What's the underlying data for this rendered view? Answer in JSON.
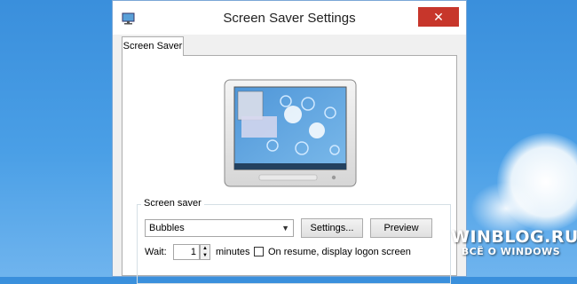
{
  "window": {
    "title": "Screen Saver Settings",
    "close_glyph": "✕",
    "app_icon": "monitor-icon",
    "close_color": "#c7362b"
  },
  "tabs": [
    {
      "label": "Screen Saver",
      "selected": true
    }
  ],
  "screen_saver_group": {
    "label": "Screen saver",
    "selected_saver": "Bubbles",
    "settings_button": "Settings...",
    "preview_button": "Preview",
    "wait_label": "Wait:",
    "wait_value": "1",
    "minutes_label": "minutes",
    "resume_checkbox_label": "On resume, display logon screen",
    "resume_checked": false
  },
  "watermark": {
    "title": "WINBLOG.RU",
    "subtitle": "ВСЁ О WINDOWS"
  }
}
